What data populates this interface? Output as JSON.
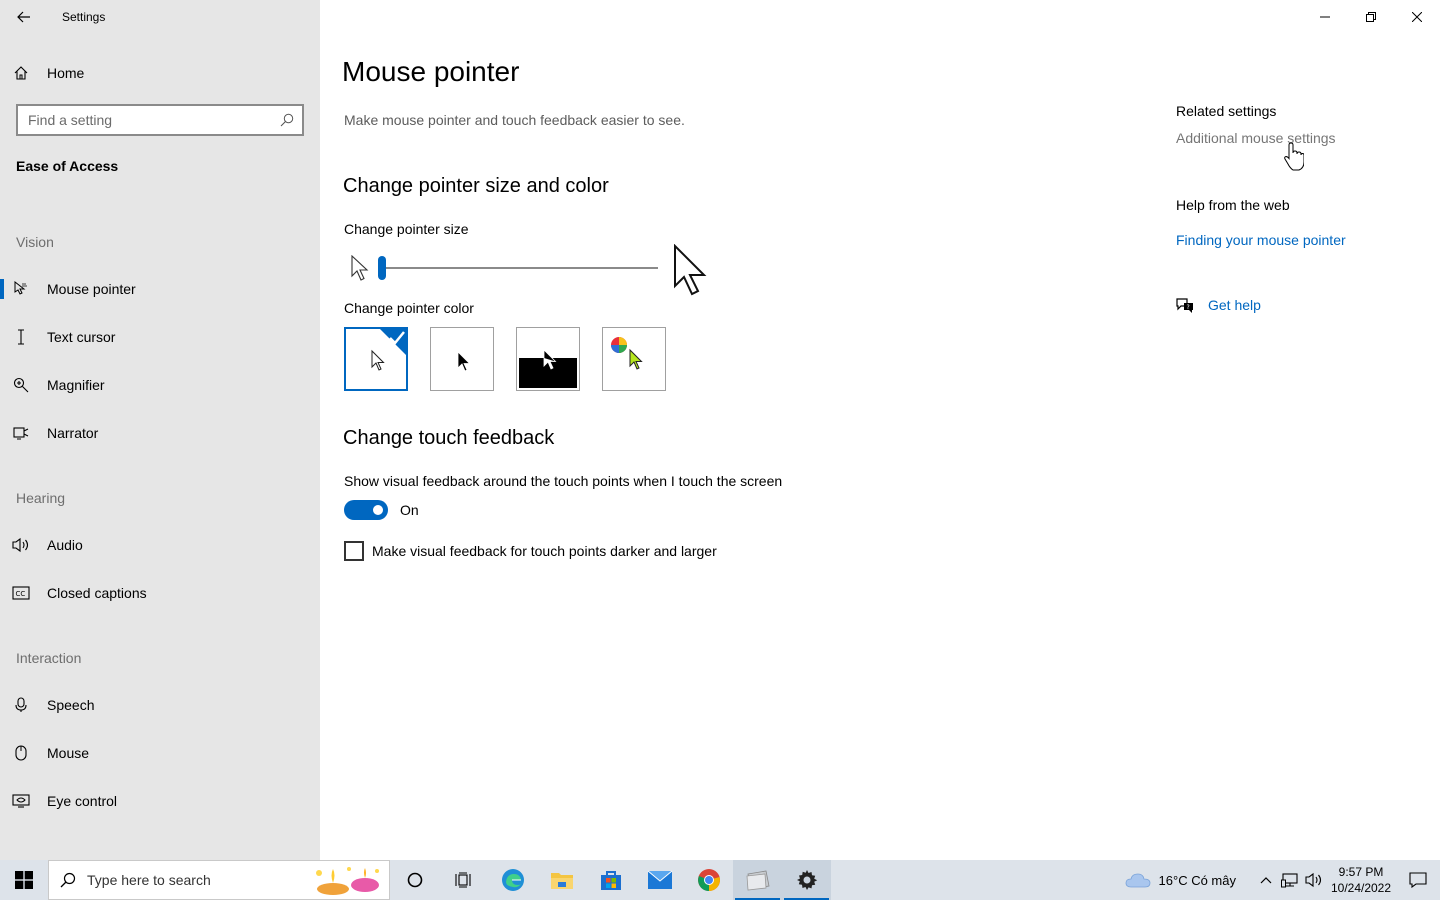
{
  "window": {
    "title": "Settings"
  },
  "sidebar": {
    "home_label": "Home",
    "search_placeholder": "Find a setting",
    "section_title": "Ease of Access",
    "groups": [
      {
        "label": "Vision"
      },
      {
        "label": "Hearing"
      },
      {
        "label": "Interaction"
      }
    ],
    "items": [
      {
        "label": "Mouse pointer",
        "icon": "mouse-pointer-icon",
        "selected": true
      },
      {
        "label": "Text cursor",
        "icon": "text-cursor-icon"
      },
      {
        "label": "Magnifier",
        "icon": "magnifier-icon"
      },
      {
        "label": "Narrator",
        "icon": "narrator-icon"
      },
      {
        "label": "Audio",
        "icon": "speaker-icon"
      },
      {
        "label": "Closed captions",
        "icon": "closed-captions-icon"
      },
      {
        "label": "Speech",
        "icon": "microphone-icon"
      },
      {
        "label": "Mouse",
        "icon": "mouse-icon"
      },
      {
        "label": "Eye control",
        "icon": "eye-control-icon"
      }
    ]
  },
  "main": {
    "title": "Mouse pointer",
    "description": "Make mouse pointer and touch feedback easier to see.",
    "pointer_section": {
      "heading": "Change pointer size and color",
      "size_label": "Change pointer size",
      "size_value": 1,
      "size_min": 1,
      "size_max": 15,
      "color_label": "Change pointer color",
      "color_options": [
        {
          "name": "white",
          "selected": true
        },
        {
          "name": "black",
          "selected": false
        },
        {
          "name": "inverted",
          "selected": false
        },
        {
          "name": "custom",
          "selected": false,
          "custom_color": "#b5e61d"
        }
      ]
    },
    "touch_section": {
      "heading": "Change touch feedback",
      "visual_feedback_label": "Show visual feedback around the touch points when I touch the screen",
      "toggle_state": "On",
      "darker_larger_label": "Make visual feedback for touch points darker and larger",
      "darker_larger_checked": false
    }
  },
  "related": {
    "heading": "Related settings",
    "additional_mouse": "Additional mouse settings",
    "help_heading": "Help from the web",
    "help_link": "Finding your mouse pointer",
    "get_help": "Get help"
  },
  "taskbar": {
    "search_placeholder": "Type here to search",
    "weather": "16°C  Có mây",
    "time": "9:57 PM",
    "date": "10/24/2022"
  },
  "colors": {
    "accent": "#0067c0",
    "sidebar_bg": "#e6e6e6",
    "taskbar_bg": "#dde3ea"
  }
}
